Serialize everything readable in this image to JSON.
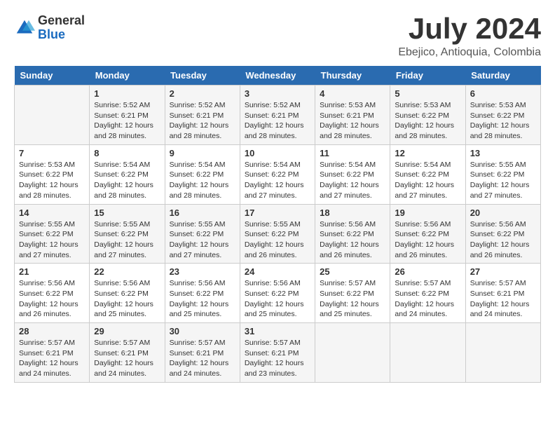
{
  "header": {
    "logo_general": "General",
    "logo_blue": "Blue",
    "month_year": "July 2024",
    "location": "Ebejico, Antioquia, Colombia"
  },
  "days_of_week": [
    "Sunday",
    "Monday",
    "Tuesday",
    "Wednesday",
    "Thursday",
    "Friday",
    "Saturday"
  ],
  "weeks": [
    [
      {
        "day": "",
        "detail": ""
      },
      {
        "day": "1",
        "detail": "Sunrise: 5:52 AM\nSunset: 6:21 PM\nDaylight: 12 hours\nand 28 minutes."
      },
      {
        "day": "2",
        "detail": "Sunrise: 5:52 AM\nSunset: 6:21 PM\nDaylight: 12 hours\nand 28 minutes."
      },
      {
        "day": "3",
        "detail": "Sunrise: 5:52 AM\nSunset: 6:21 PM\nDaylight: 12 hours\nand 28 minutes."
      },
      {
        "day": "4",
        "detail": "Sunrise: 5:53 AM\nSunset: 6:21 PM\nDaylight: 12 hours\nand 28 minutes."
      },
      {
        "day": "5",
        "detail": "Sunrise: 5:53 AM\nSunset: 6:22 PM\nDaylight: 12 hours\nand 28 minutes."
      },
      {
        "day": "6",
        "detail": "Sunrise: 5:53 AM\nSunset: 6:22 PM\nDaylight: 12 hours\nand 28 minutes."
      }
    ],
    [
      {
        "day": "7",
        "detail": "Sunrise: 5:53 AM\nSunset: 6:22 PM\nDaylight: 12 hours\nand 28 minutes."
      },
      {
        "day": "8",
        "detail": "Sunrise: 5:54 AM\nSunset: 6:22 PM\nDaylight: 12 hours\nand 28 minutes."
      },
      {
        "day": "9",
        "detail": "Sunrise: 5:54 AM\nSunset: 6:22 PM\nDaylight: 12 hours\nand 28 minutes."
      },
      {
        "day": "10",
        "detail": "Sunrise: 5:54 AM\nSunset: 6:22 PM\nDaylight: 12 hours\nand 27 minutes."
      },
      {
        "day": "11",
        "detail": "Sunrise: 5:54 AM\nSunset: 6:22 PM\nDaylight: 12 hours\nand 27 minutes."
      },
      {
        "day": "12",
        "detail": "Sunrise: 5:54 AM\nSunset: 6:22 PM\nDaylight: 12 hours\nand 27 minutes."
      },
      {
        "day": "13",
        "detail": "Sunrise: 5:55 AM\nSunset: 6:22 PM\nDaylight: 12 hours\nand 27 minutes."
      }
    ],
    [
      {
        "day": "14",
        "detail": "Sunrise: 5:55 AM\nSunset: 6:22 PM\nDaylight: 12 hours\nand 27 minutes."
      },
      {
        "day": "15",
        "detail": "Sunrise: 5:55 AM\nSunset: 6:22 PM\nDaylight: 12 hours\nand 27 minutes."
      },
      {
        "day": "16",
        "detail": "Sunrise: 5:55 AM\nSunset: 6:22 PM\nDaylight: 12 hours\nand 27 minutes."
      },
      {
        "day": "17",
        "detail": "Sunrise: 5:55 AM\nSunset: 6:22 PM\nDaylight: 12 hours\nand 26 minutes."
      },
      {
        "day": "18",
        "detail": "Sunrise: 5:56 AM\nSunset: 6:22 PM\nDaylight: 12 hours\nand 26 minutes."
      },
      {
        "day": "19",
        "detail": "Sunrise: 5:56 AM\nSunset: 6:22 PM\nDaylight: 12 hours\nand 26 minutes."
      },
      {
        "day": "20",
        "detail": "Sunrise: 5:56 AM\nSunset: 6:22 PM\nDaylight: 12 hours\nand 26 minutes."
      }
    ],
    [
      {
        "day": "21",
        "detail": "Sunrise: 5:56 AM\nSunset: 6:22 PM\nDaylight: 12 hours\nand 26 minutes."
      },
      {
        "day": "22",
        "detail": "Sunrise: 5:56 AM\nSunset: 6:22 PM\nDaylight: 12 hours\nand 25 minutes."
      },
      {
        "day": "23",
        "detail": "Sunrise: 5:56 AM\nSunset: 6:22 PM\nDaylight: 12 hours\nand 25 minutes."
      },
      {
        "day": "24",
        "detail": "Sunrise: 5:56 AM\nSunset: 6:22 PM\nDaylight: 12 hours\nand 25 minutes."
      },
      {
        "day": "25",
        "detail": "Sunrise: 5:57 AM\nSunset: 6:22 PM\nDaylight: 12 hours\nand 25 minutes."
      },
      {
        "day": "26",
        "detail": "Sunrise: 5:57 AM\nSunset: 6:22 PM\nDaylight: 12 hours\nand 24 minutes."
      },
      {
        "day": "27",
        "detail": "Sunrise: 5:57 AM\nSunset: 6:21 PM\nDaylight: 12 hours\nand 24 minutes."
      }
    ],
    [
      {
        "day": "28",
        "detail": "Sunrise: 5:57 AM\nSunset: 6:21 PM\nDaylight: 12 hours\nand 24 minutes."
      },
      {
        "day": "29",
        "detail": "Sunrise: 5:57 AM\nSunset: 6:21 PM\nDaylight: 12 hours\nand 24 minutes."
      },
      {
        "day": "30",
        "detail": "Sunrise: 5:57 AM\nSunset: 6:21 PM\nDaylight: 12 hours\nand 24 minutes."
      },
      {
        "day": "31",
        "detail": "Sunrise: 5:57 AM\nSunset: 6:21 PM\nDaylight: 12 hours\nand 23 minutes."
      },
      {
        "day": "",
        "detail": ""
      },
      {
        "day": "",
        "detail": ""
      },
      {
        "day": "",
        "detail": ""
      }
    ]
  ]
}
